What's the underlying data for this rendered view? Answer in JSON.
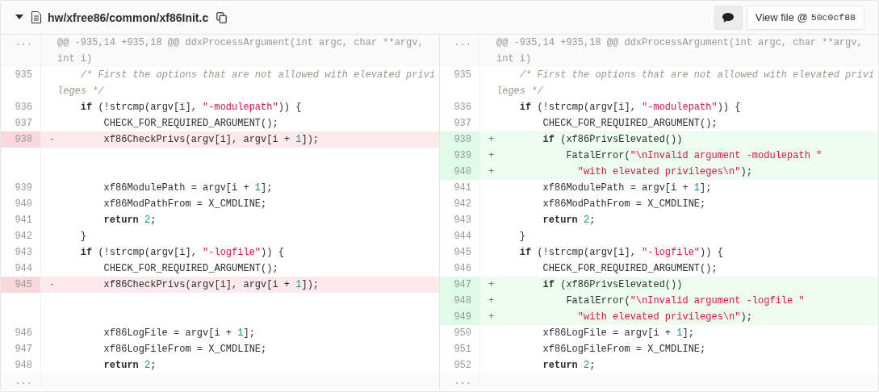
{
  "file": {
    "path": "hw/xfree86/common/xf86Init.c",
    "expanded": true
  },
  "view_file_button": {
    "label": "View file @",
    "commit": "50c0cf88"
  },
  "rows": [
    {
      "left": {
        "kind": "hunk",
        "number": "...",
        "text": "@@ -935,14 +935,18 @@ ddxProcessArgument(int argc, char **argv, int i)"
      },
      "right": {
        "kind": "hunk",
        "number": "...",
        "text": "@@ -935,14 +935,18 @@ ddxProcessArgument(int argc, char **argv, int i)"
      }
    },
    {
      "left": {
        "kind": "context",
        "number": "935",
        "tokens": [
          {
            "kind": "comment",
            "text": "    /* First the options that are not allowed with elevated privileges */"
          }
        ]
      },
      "right": {
        "kind": "context",
        "number": "935",
        "tokens": [
          {
            "kind": "comment",
            "text": "    /* First the options that are not allowed with elevated privileges */"
          }
        ]
      }
    },
    {
      "left": {
        "kind": "context",
        "number": "936",
        "tokens": [
          {
            "kind": "keyword",
            "text": "    if"
          },
          {
            "kind": "plain",
            "text": " (!strcmp(argv[i], "
          },
          {
            "kind": "string",
            "text": "\"-modulepath\""
          },
          {
            "kind": "plain",
            "text": ")) {"
          }
        ]
      },
      "right": {
        "kind": "context",
        "number": "936",
        "tokens": [
          {
            "kind": "keyword",
            "text": "    if"
          },
          {
            "kind": "plain",
            "text": " (!strcmp(argv[i], "
          },
          {
            "kind": "string",
            "text": "\"-modulepath\""
          },
          {
            "kind": "plain",
            "text": ")) {"
          }
        ]
      }
    },
    {
      "left": {
        "kind": "context",
        "number": "937",
        "tokens": [
          {
            "kind": "plain",
            "text": "        CHECK_FOR_REQUIRED_ARGUMENT();"
          }
        ]
      },
      "right": {
        "kind": "context",
        "number": "937",
        "tokens": [
          {
            "kind": "plain",
            "text": "        CHECK_FOR_REQUIRED_ARGUMENT();"
          }
        ]
      }
    },
    {
      "left": {
        "kind": "deletion",
        "number": "938",
        "sign": "-",
        "tokens": [
          {
            "kind": "plain",
            "text": "        xf86CheckPrivs(argv[i], argv[i + "
          },
          {
            "kind": "number",
            "text": "1"
          },
          {
            "kind": "plain",
            "text": "]);"
          }
        ]
      },
      "right": {
        "kind": "addition",
        "number": "938",
        "sign": "+",
        "tokens": [
          {
            "kind": "keyword",
            "text": "        if"
          },
          {
            "kind": "plain",
            "text": " (xf86PrivsElevated())"
          }
        ]
      }
    },
    {
      "left": null,
      "right": {
        "kind": "addition",
        "number": "939",
        "sign": "+",
        "tokens": [
          {
            "kind": "plain",
            "text": "            FatalError("
          },
          {
            "kind": "string",
            "text": "\"\\nInvalid argument -modulepath \""
          }
        ]
      }
    },
    {
      "left": null,
      "right": {
        "kind": "addition",
        "number": "940",
        "sign": "+",
        "tokens": [
          {
            "kind": "string",
            "text": "              \"with elevated privileges\\n\""
          },
          {
            "kind": "plain",
            "text": ");"
          }
        ]
      }
    },
    {
      "left": {
        "kind": "context",
        "number": "939",
        "tokens": [
          {
            "kind": "plain",
            "text": "        xf86ModulePath = argv[i + "
          },
          {
            "kind": "number",
            "text": "1"
          },
          {
            "kind": "plain",
            "text": "];"
          }
        ]
      },
      "right": {
        "kind": "context",
        "number": "941",
        "tokens": [
          {
            "kind": "plain",
            "text": "        xf86ModulePath = argv[i + "
          },
          {
            "kind": "number",
            "text": "1"
          },
          {
            "kind": "plain",
            "text": "];"
          }
        ]
      }
    },
    {
      "left": {
        "kind": "context",
        "number": "940",
        "tokens": [
          {
            "kind": "plain",
            "text": "        xf86ModPathFrom = X_CMDLINE;"
          }
        ]
      },
      "right": {
        "kind": "context",
        "number": "942",
        "tokens": [
          {
            "kind": "plain",
            "text": "        xf86ModPathFrom = X_CMDLINE;"
          }
        ]
      }
    },
    {
      "left": {
        "kind": "context",
        "number": "941",
        "tokens": [
          {
            "kind": "keyword",
            "text": "        return"
          },
          {
            "kind": "number",
            "text": " 2"
          },
          {
            "kind": "plain",
            "text": ";"
          }
        ]
      },
      "right": {
        "kind": "context",
        "number": "943",
        "tokens": [
          {
            "kind": "keyword",
            "text": "        return"
          },
          {
            "kind": "number",
            "text": " 2"
          },
          {
            "kind": "plain",
            "text": ";"
          }
        ]
      }
    },
    {
      "left": {
        "kind": "context",
        "number": "942",
        "tokens": [
          {
            "kind": "plain",
            "text": "    }"
          }
        ]
      },
      "right": {
        "kind": "context",
        "number": "944",
        "tokens": [
          {
            "kind": "plain",
            "text": "    }"
          }
        ]
      }
    },
    {
      "left": {
        "kind": "context",
        "number": "943",
        "tokens": [
          {
            "kind": "keyword",
            "text": "    if"
          },
          {
            "kind": "plain",
            "text": " (!strcmp(argv[i], "
          },
          {
            "kind": "string",
            "text": "\"-logfile\""
          },
          {
            "kind": "plain",
            "text": ")) {"
          }
        ]
      },
      "right": {
        "kind": "context",
        "number": "945",
        "tokens": [
          {
            "kind": "keyword",
            "text": "    if"
          },
          {
            "kind": "plain",
            "text": " (!strcmp(argv[i], "
          },
          {
            "kind": "string",
            "text": "\"-logfile\""
          },
          {
            "kind": "plain",
            "text": ")) {"
          }
        ]
      }
    },
    {
      "left": {
        "kind": "context",
        "number": "944",
        "tokens": [
          {
            "kind": "plain",
            "text": "        CHECK_FOR_REQUIRED_ARGUMENT();"
          }
        ]
      },
      "right": {
        "kind": "context",
        "number": "946",
        "tokens": [
          {
            "kind": "plain",
            "text": "        CHECK_FOR_REQUIRED_ARGUMENT();"
          }
        ]
      }
    },
    {
      "left": {
        "kind": "deletion",
        "number": "945",
        "sign": "-",
        "tokens": [
          {
            "kind": "plain",
            "text": "        xf86CheckPrivs(argv[i], argv[i + "
          },
          {
            "kind": "number",
            "text": "1"
          },
          {
            "kind": "plain",
            "text": "]);"
          }
        ]
      },
      "right": {
        "kind": "addition",
        "number": "947",
        "sign": "+",
        "tokens": [
          {
            "kind": "keyword",
            "text": "        if"
          },
          {
            "kind": "plain",
            "text": " (xf86PrivsElevated())"
          }
        ]
      }
    },
    {
      "left": null,
      "right": {
        "kind": "addition",
        "number": "948",
        "sign": "+",
        "tokens": [
          {
            "kind": "plain",
            "text": "            FatalError("
          },
          {
            "kind": "string",
            "text": "\"\\nInvalid argument -logfile \""
          }
        ]
      }
    },
    {
      "left": null,
      "right": {
        "kind": "addition",
        "number": "949",
        "sign": "+",
        "tokens": [
          {
            "kind": "string",
            "text": "              \"with elevated privileges\\n\""
          },
          {
            "kind": "plain",
            "text": ");"
          }
        ]
      }
    },
    {
      "left": {
        "kind": "context",
        "number": "946",
        "tokens": [
          {
            "kind": "plain",
            "text": "        xf86LogFile = argv[i + "
          },
          {
            "kind": "number",
            "text": "1"
          },
          {
            "kind": "plain",
            "text": "];"
          }
        ]
      },
      "right": {
        "kind": "context",
        "number": "950",
        "tokens": [
          {
            "kind": "plain",
            "text": "        xf86LogFile = argv[i + "
          },
          {
            "kind": "number",
            "text": "1"
          },
          {
            "kind": "plain",
            "text": "];"
          }
        ]
      }
    },
    {
      "left": {
        "kind": "context",
        "number": "947",
        "tokens": [
          {
            "kind": "plain",
            "text": "        xf86LogFileFrom = X_CMDLINE;"
          }
        ]
      },
      "right": {
        "kind": "context",
        "number": "951",
        "tokens": [
          {
            "kind": "plain",
            "text": "        xf86LogFileFrom = X_CMDLINE;"
          }
        ]
      }
    },
    {
      "left": {
        "kind": "context",
        "number": "948",
        "tokens": [
          {
            "kind": "keyword",
            "text": "        return"
          },
          {
            "kind": "number",
            "text": " 2"
          },
          {
            "kind": "plain",
            "text": ";"
          }
        ]
      },
      "right": {
        "kind": "context",
        "number": "952",
        "tokens": [
          {
            "kind": "keyword",
            "text": "        return"
          },
          {
            "kind": "number",
            "text": " 2"
          },
          {
            "kind": "plain",
            "text": ";"
          }
        ]
      }
    },
    {
      "left": {
        "kind": "expander",
        "number": "..."
      },
      "right": {
        "kind": "expander",
        "number": "..."
      }
    }
  ]
}
